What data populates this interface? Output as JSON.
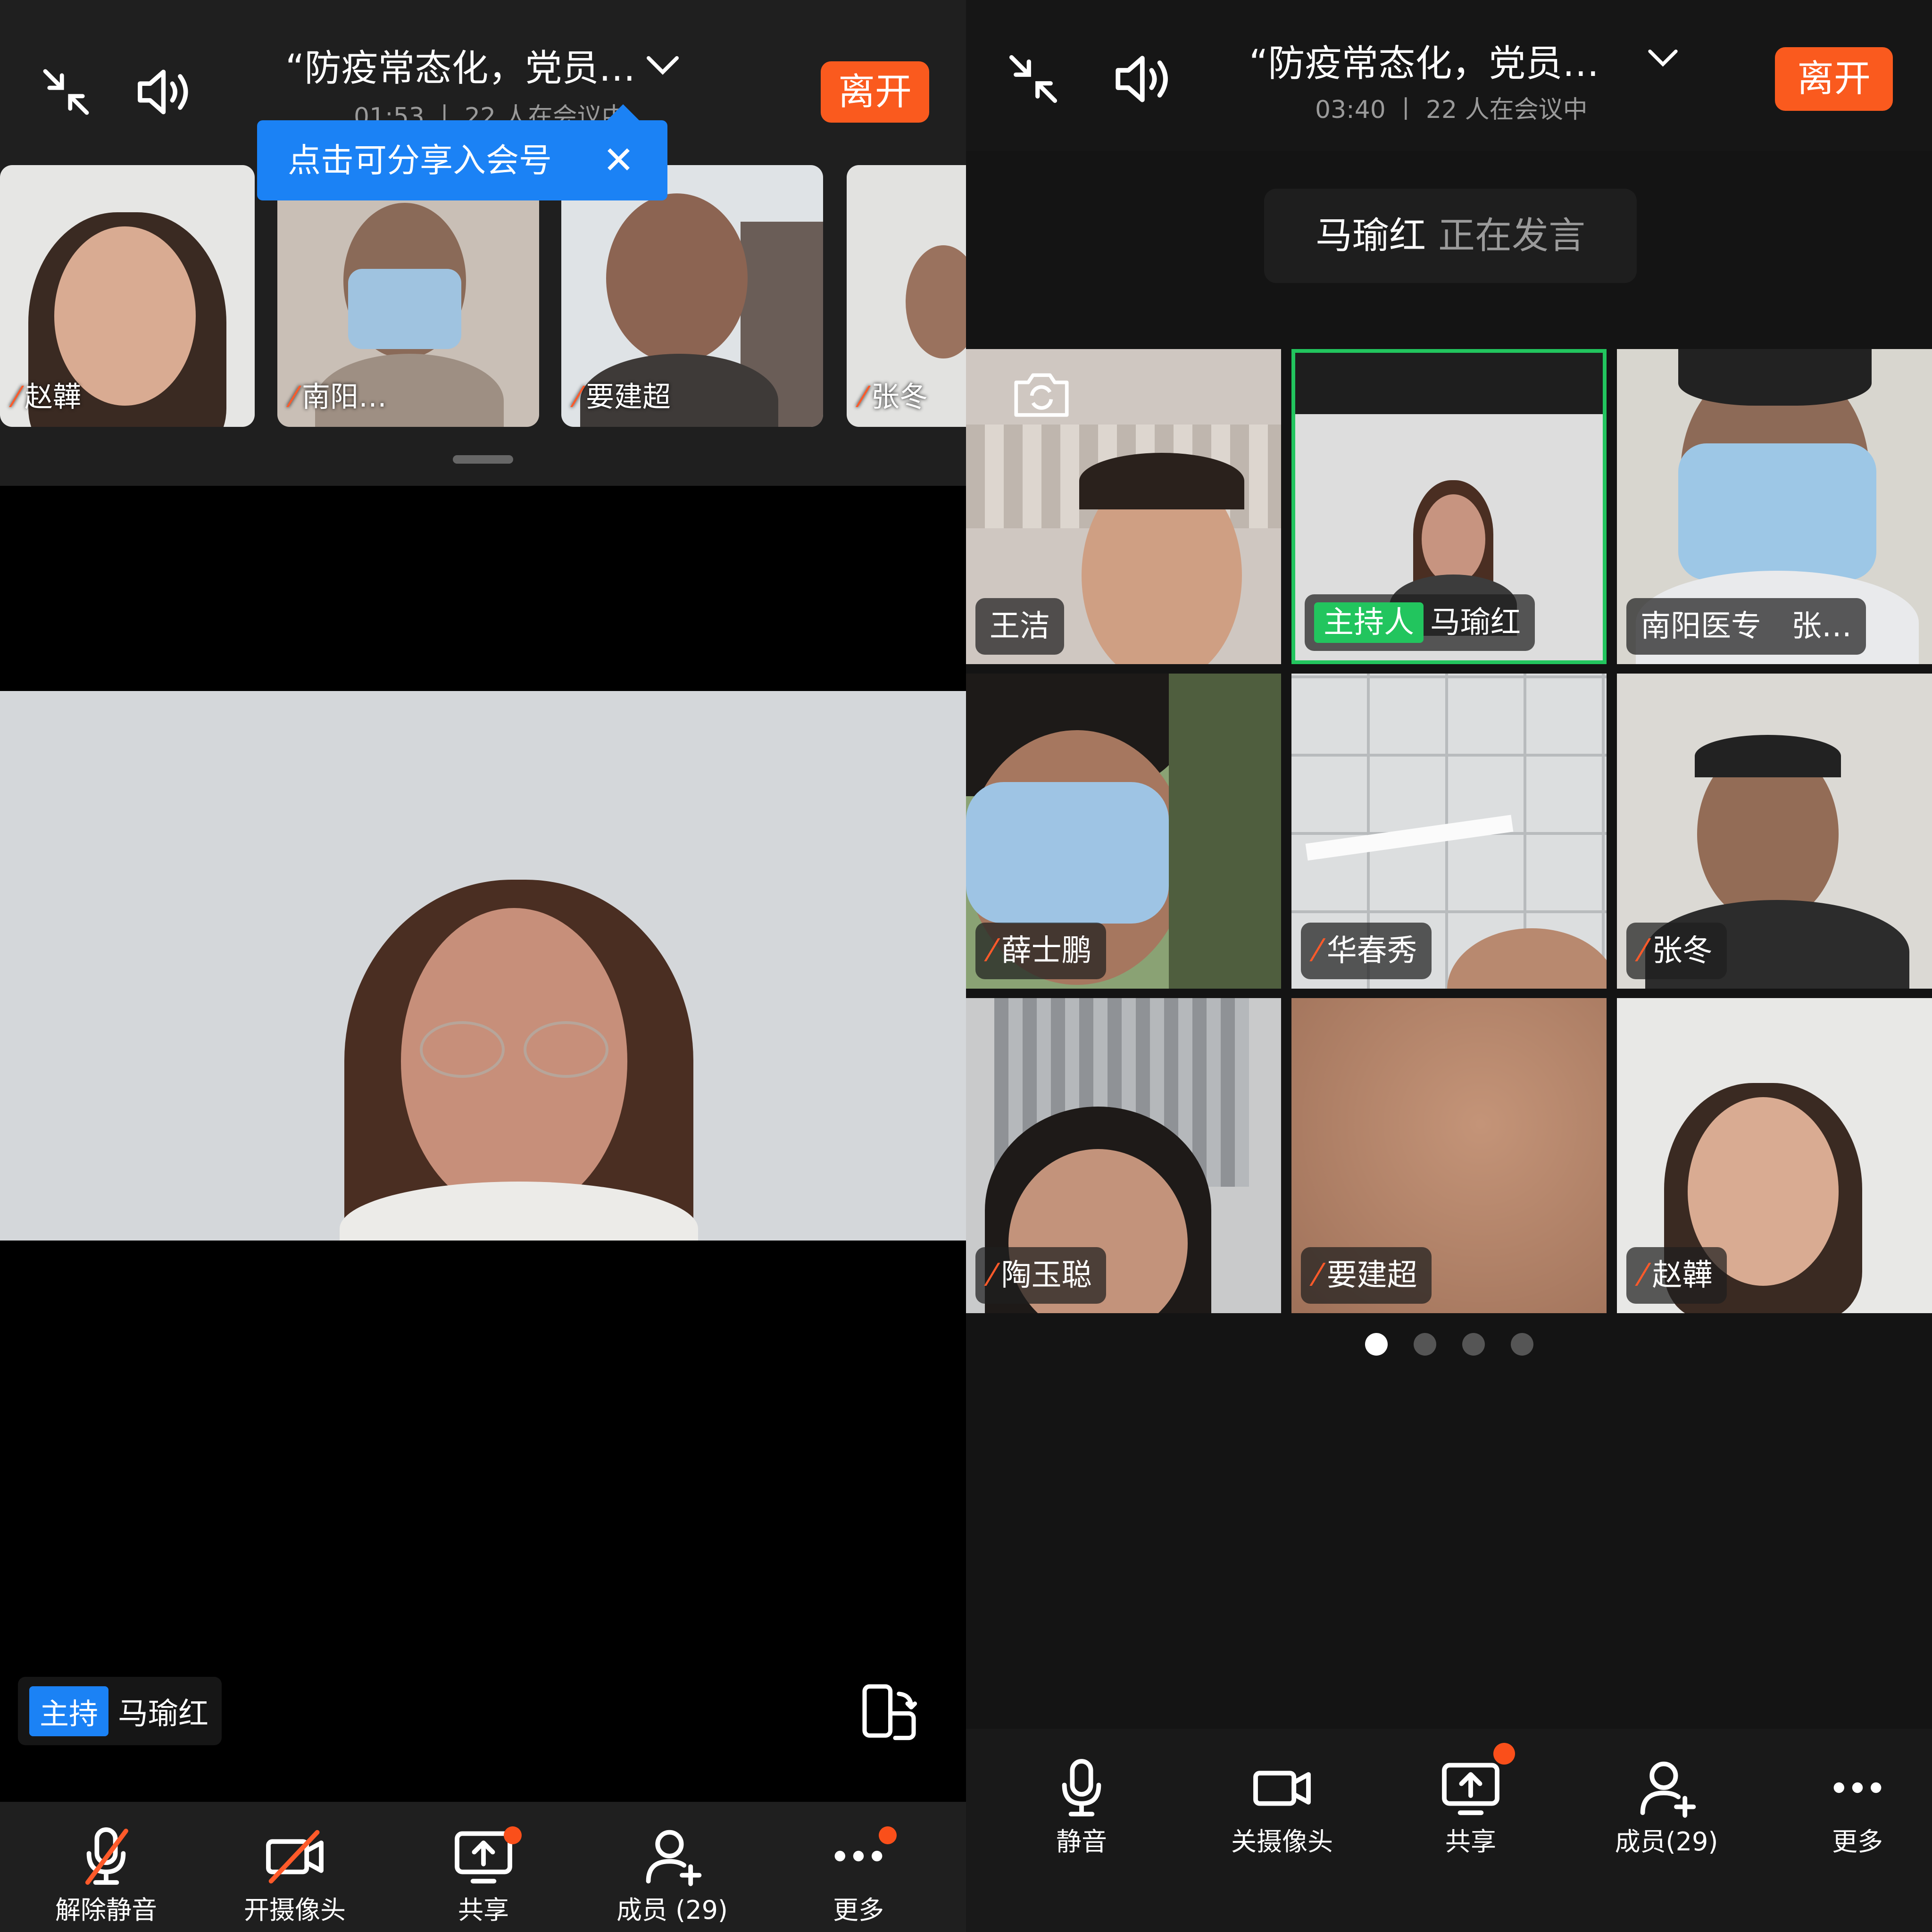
{
  "left": {
    "meeting_title": "“防疫常态化，党员…",
    "subtitle": "01:53 丨 22 人在会议中",
    "leave_label": "离开",
    "tooltip": "点击可分享入会号",
    "tooltip_close": "✕",
    "thumbnails": [
      {
        "name": "赵韡"
      },
      {
        "name": "南阳…"
      },
      {
        "name": "要建超"
      },
      {
        "name": "张冬"
      }
    ],
    "host_tag": "主持",
    "host_name": "马瑜红",
    "toolbar": {
      "unmute": "解除静音",
      "camera_on": "开摄像头",
      "share": "共享",
      "members": "成员 (29)",
      "more": "更多"
    }
  },
  "right": {
    "meeting_title": "“防疫常态化，党员…",
    "subtitle": "03:40 丨 22 人在会议中",
    "leave_label": "离开",
    "speaker_name": "马瑜红",
    "speaker_status": "正在发言",
    "tiles": [
      {
        "name": "王洁",
        "muted": false
      },
      {
        "name": "马瑜红",
        "tag": "主持人",
        "muted": false
      },
      {
        "name": "南阳医专　张…",
        "muted": false
      },
      {
        "name": "薛士鹏",
        "muted": true
      },
      {
        "name": "华春秀",
        "muted": true
      },
      {
        "name": "张冬",
        "muted": true
      },
      {
        "name": "陶玉聪",
        "muted": true
      },
      {
        "name": "要建超",
        "muted": true
      },
      {
        "name": "赵韡",
        "muted": true
      }
    ],
    "page_count": 4,
    "active_page": 1,
    "toolbar": {
      "mute": "静音",
      "camera_off": "关摄像头",
      "share": "共享",
      "members": "成员(29)",
      "more": "更多"
    }
  },
  "colors": {
    "accent_orange": "#fa5a1e",
    "accent_blue": "#1b82f5",
    "host_green": "#22c55e",
    "mute_red": "#ff5a2a"
  },
  "icons": [
    "collapse-icon",
    "speaker-icon",
    "chevron-down-icon",
    "mic-off-icon",
    "camera-off-icon",
    "share-screen-icon",
    "add-member-icon",
    "more-icon",
    "mic-icon",
    "camera-icon",
    "rotate-screen-icon",
    "switch-camera-icon"
  ]
}
